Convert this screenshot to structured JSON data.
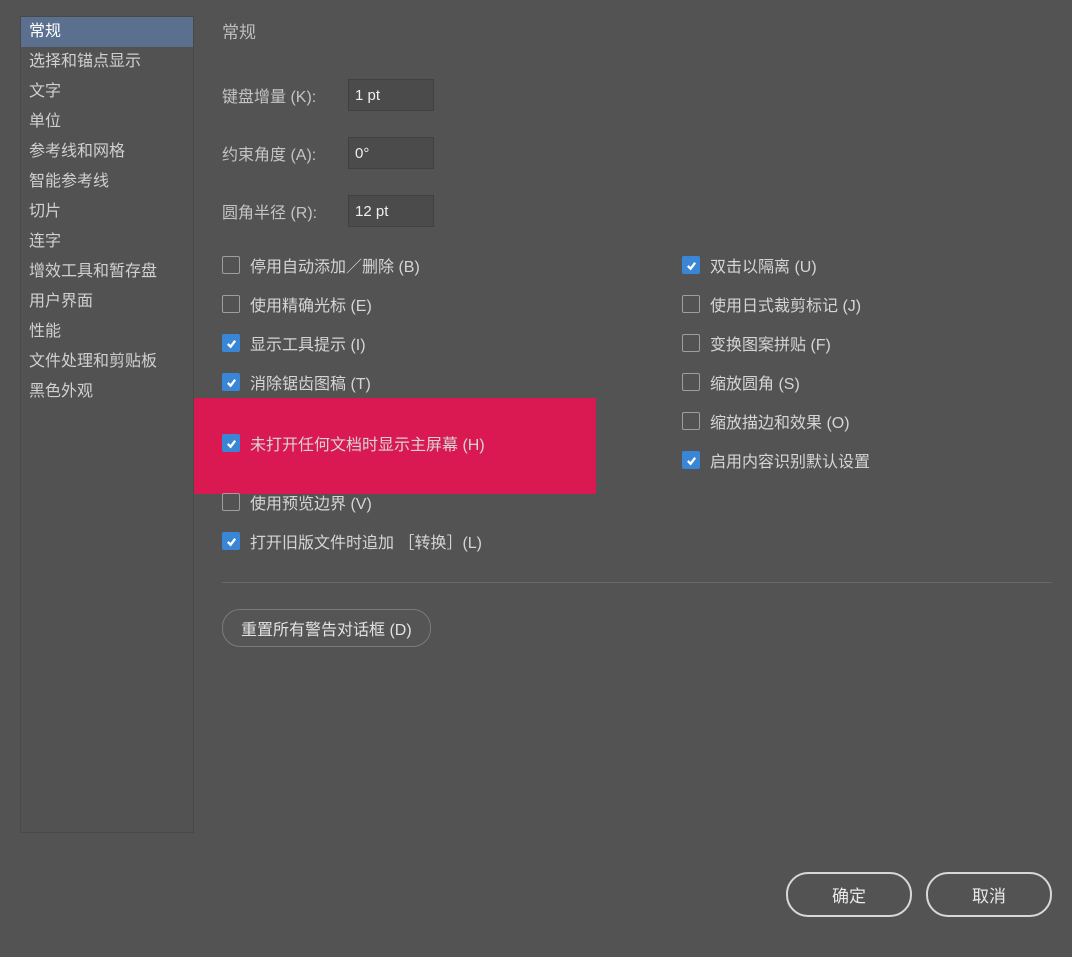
{
  "sidebar": {
    "items": [
      {
        "label": "常规",
        "selected": true
      },
      {
        "label": "选择和锚点显示",
        "selected": false
      },
      {
        "label": "文字",
        "selected": false
      },
      {
        "label": "单位",
        "selected": false
      },
      {
        "label": "参考线和网格",
        "selected": false
      },
      {
        "label": "智能参考线",
        "selected": false
      },
      {
        "label": "切片",
        "selected": false
      },
      {
        "label": "连字",
        "selected": false
      },
      {
        "label": "增效工具和暂存盘",
        "selected": false
      },
      {
        "label": "用户界面",
        "selected": false
      },
      {
        "label": "性能",
        "selected": false
      },
      {
        "label": "文件处理和剪贴板",
        "selected": false
      },
      {
        "label": "黑色外观",
        "selected": false
      }
    ]
  },
  "main": {
    "title": "常规",
    "params": {
      "keyboard_increment": {
        "label": "键盘增量 (K):",
        "value": "1 pt"
      },
      "constrain_angle": {
        "label": "约束角度 (A):",
        "value": "0°"
      },
      "corner_radius": {
        "label": "圆角半径 (R):",
        "value": "12 pt"
      }
    },
    "checks_left": [
      {
        "label": "停用自动添加／删除 (B)",
        "checked": false
      },
      {
        "label": "使用精确光标 (E)",
        "checked": false
      },
      {
        "label": "显示工具提示 (I)",
        "checked": true
      },
      {
        "label": "消除锯齿图稿 (T)",
        "checked": true
      },
      {
        "label": "未打开任何文档时显示主屏幕 (H)",
        "checked": true,
        "highlighted": true
      },
      {
        "label": "使用预览边界 (V)",
        "checked": false
      },
      {
        "label": "打开旧版文件时追加 ［转换］(L)",
        "checked": true
      }
    ],
    "checks_right": [
      {
        "label": "双击以隔离 (U)",
        "checked": true
      },
      {
        "label": "使用日式裁剪标记 (J)",
        "checked": false
      },
      {
        "label": "变换图案拼贴 (F)",
        "checked": false
      },
      {
        "label": "缩放圆角 (S)",
        "checked": false
      },
      {
        "label": "缩放描边和效果 (O)",
        "checked": false
      },
      {
        "label": "启用内容识别默认设置",
        "checked": true
      }
    ],
    "reset_button": "重置所有警告对话框 (D)"
  },
  "footer": {
    "ok": "确定",
    "cancel": "取消"
  }
}
